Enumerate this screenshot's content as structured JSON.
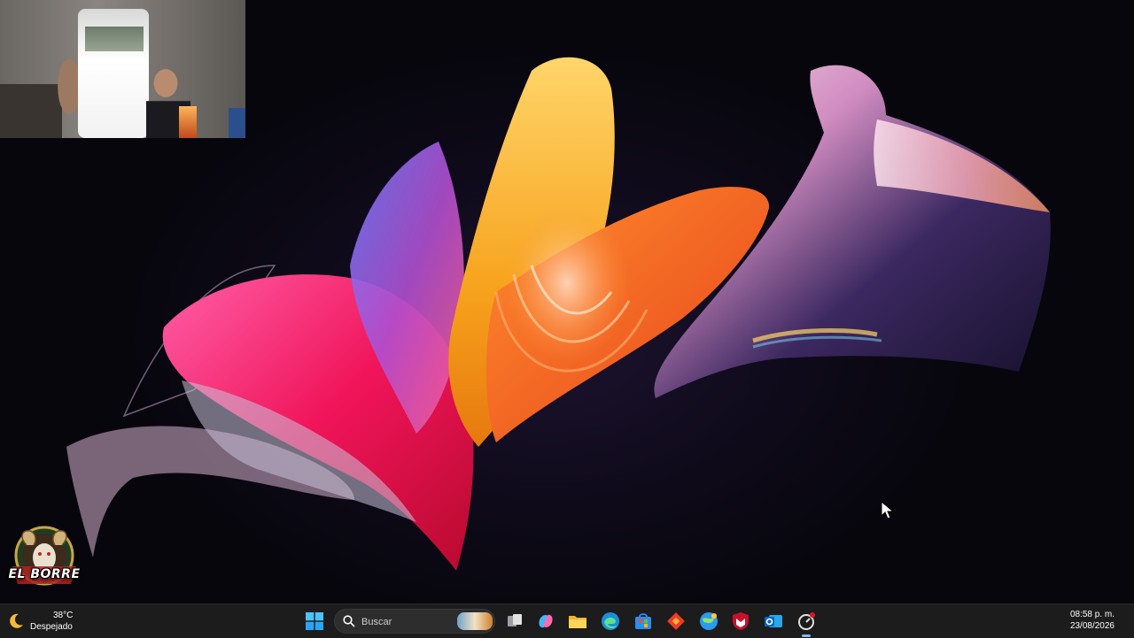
{
  "brand": {
    "logo_text": "EL BORRE"
  },
  "taskbar": {
    "weather": {
      "temperature": "38°C",
      "condition": "Despejado",
      "icon": "moon-icon"
    },
    "search": {
      "placeholder": "Buscar"
    },
    "apps": [
      {
        "name": "start-button",
        "icon": "windows-logo-icon"
      },
      {
        "name": "task-view-button",
        "icon": "task-view-icon"
      },
      {
        "name": "copilot-button",
        "icon": "copilot-icon"
      },
      {
        "name": "file-explorer-button",
        "icon": "folder-icon"
      },
      {
        "name": "edge-button",
        "icon": "edge-icon"
      },
      {
        "name": "store-button",
        "icon": "store-icon"
      },
      {
        "name": "anydesk-button",
        "icon": "anydesk-icon"
      },
      {
        "name": "browser-button",
        "icon": "globe-icon"
      },
      {
        "name": "mcafee-button",
        "icon": "mcafee-shield-icon"
      },
      {
        "name": "outlook-button",
        "icon": "outlook-icon"
      },
      {
        "name": "recording-app-button",
        "icon": "recording-icon"
      }
    ],
    "clock": {
      "time": "08:58 p. m.",
      "date": "23/08/2026"
    },
    "colors": {
      "taskbar_bg": "#1c1c1c",
      "accent": "#7fb8f5"
    }
  }
}
